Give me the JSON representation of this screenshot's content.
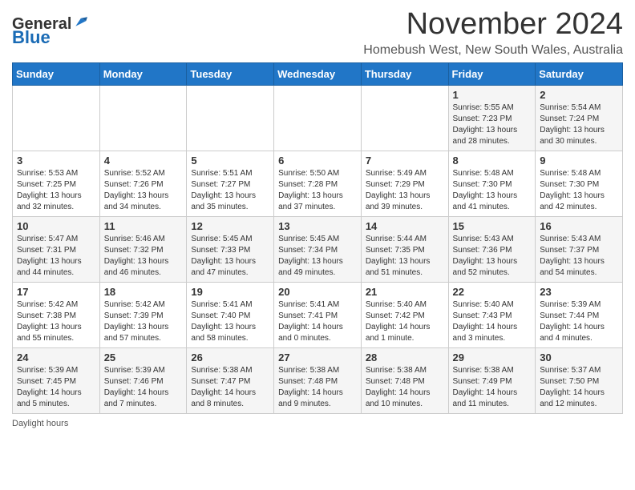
{
  "logo": {
    "general": "General",
    "blue": "Blue"
  },
  "title": "November 2024",
  "location": "Homebush West, New South Wales, Australia",
  "days_of_week": [
    "Sunday",
    "Monday",
    "Tuesday",
    "Wednesday",
    "Thursday",
    "Friday",
    "Saturday"
  ],
  "footer": "Daylight hours",
  "weeks": [
    [
      {
        "day": "",
        "info": ""
      },
      {
        "day": "",
        "info": ""
      },
      {
        "day": "",
        "info": ""
      },
      {
        "day": "",
        "info": ""
      },
      {
        "day": "",
        "info": ""
      },
      {
        "day": "1",
        "info": "Sunrise: 5:55 AM\nSunset: 7:23 PM\nDaylight: 13 hours\nand 28 minutes."
      },
      {
        "day": "2",
        "info": "Sunrise: 5:54 AM\nSunset: 7:24 PM\nDaylight: 13 hours\nand 30 minutes."
      }
    ],
    [
      {
        "day": "3",
        "info": "Sunrise: 5:53 AM\nSunset: 7:25 PM\nDaylight: 13 hours\nand 32 minutes."
      },
      {
        "day": "4",
        "info": "Sunrise: 5:52 AM\nSunset: 7:26 PM\nDaylight: 13 hours\nand 34 minutes."
      },
      {
        "day": "5",
        "info": "Sunrise: 5:51 AM\nSunset: 7:27 PM\nDaylight: 13 hours\nand 35 minutes."
      },
      {
        "day": "6",
        "info": "Sunrise: 5:50 AM\nSunset: 7:28 PM\nDaylight: 13 hours\nand 37 minutes."
      },
      {
        "day": "7",
        "info": "Sunrise: 5:49 AM\nSunset: 7:29 PM\nDaylight: 13 hours\nand 39 minutes."
      },
      {
        "day": "8",
        "info": "Sunrise: 5:48 AM\nSunset: 7:30 PM\nDaylight: 13 hours\nand 41 minutes."
      },
      {
        "day": "9",
        "info": "Sunrise: 5:48 AM\nSunset: 7:30 PM\nDaylight: 13 hours\nand 42 minutes."
      }
    ],
    [
      {
        "day": "10",
        "info": "Sunrise: 5:47 AM\nSunset: 7:31 PM\nDaylight: 13 hours\nand 44 minutes."
      },
      {
        "day": "11",
        "info": "Sunrise: 5:46 AM\nSunset: 7:32 PM\nDaylight: 13 hours\nand 46 minutes."
      },
      {
        "day": "12",
        "info": "Sunrise: 5:45 AM\nSunset: 7:33 PM\nDaylight: 13 hours\nand 47 minutes."
      },
      {
        "day": "13",
        "info": "Sunrise: 5:45 AM\nSunset: 7:34 PM\nDaylight: 13 hours\nand 49 minutes."
      },
      {
        "day": "14",
        "info": "Sunrise: 5:44 AM\nSunset: 7:35 PM\nDaylight: 13 hours\nand 51 minutes."
      },
      {
        "day": "15",
        "info": "Sunrise: 5:43 AM\nSunset: 7:36 PM\nDaylight: 13 hours\nand 52 minutes."
      },
      {
        "day": "16",
        "info": "Sunrise: 5:43 AM\nSunset: 7:37 PM\nDaylight: 13 hours\nand 54 minutes."
      }
    ],
    [
      {
        "day": "17",
        "info": "Sunrise: 5:42 AM\nSunset: 7:38 PM\nDaylight: 13 hours\nand 55 minutes."
      },
      {
        "day": "18",
        "info": "Sunrise: 5:42 AM\nSunset: 7:39 PM\nDaylight: 13 hours\nand 57 minutes."
      },
      {
        "day": "19",
        "info": "Sunrise: 5:41 AM\nSunset: 7:40 PM\nDaylight: 13 hours\nand 58 minutes."
      },
      {
        "day": "20",
        "info": "Sunrise: 5:41 AM\nSunset: 7:41 PM\nDaylight: 14 hours\nand 0 minutes."
      },
      {
        "day": "21",
        "info": "Sunrise: 5:40 AM\nSunset: 7:42 PM\nDaylight: 14 hours\nand 1 minute."
      },
      {
        "day": "22",
        "info": "Sunrise: 5:40 AM\nSunset: 7:43 PM\nDaylight: 14 hours\nand 3 minutes."
      },
      {
        "day": "23",
        "info": "Sunrise: 5:39 AM\nSunset: 7:44 PM\nDaylight: 14 hours\nand 4 minutes."
      }
    ],
    [
      {
        "day": "24",
        "info": "Sunrise: 5:39 AM\nSunset: 7:45 PM\nDaylight: 14 hours\nand 5 minutes."
      },
      {
        "day": "25",
        "info": "Sunrise: 5:39 AM\nSunset: 7:46 PM\nDaylight: 14 hours\nand 7 minutes."
      },
      {
        "day": "26",
        "info": "Sunrise: 5:38 AM\nSunset: 7:47 PM\nDaylight: 14 hours\nand 8 minutes."
      },
      {
        "day": "27",
        "info": "Sunrise: 5:38 AM\nSunset: 7:48 PM\nDaylight: 14 hours\nand 9 minutes."
      },
      {
        "day": "28",
        "info": "Sunrise: 5:38 AM\nSunset: 7:48 PM\nDaylight: 14 hours\nand 10 minutes."
      },
      {
        "day": "29",
        "info": "Sunrise: 5:38 AM\nSunset: 7:49 PM\nDaylight: 14 hours\nand 11 minutes."
      },
      {
        "day": "30",
        "info": "Sunrise: 5:37 AM\nSunset: 7:50 PM\nDaylight: 14 hours\nand 12 minutes."
      }
    ]
  ]
}
